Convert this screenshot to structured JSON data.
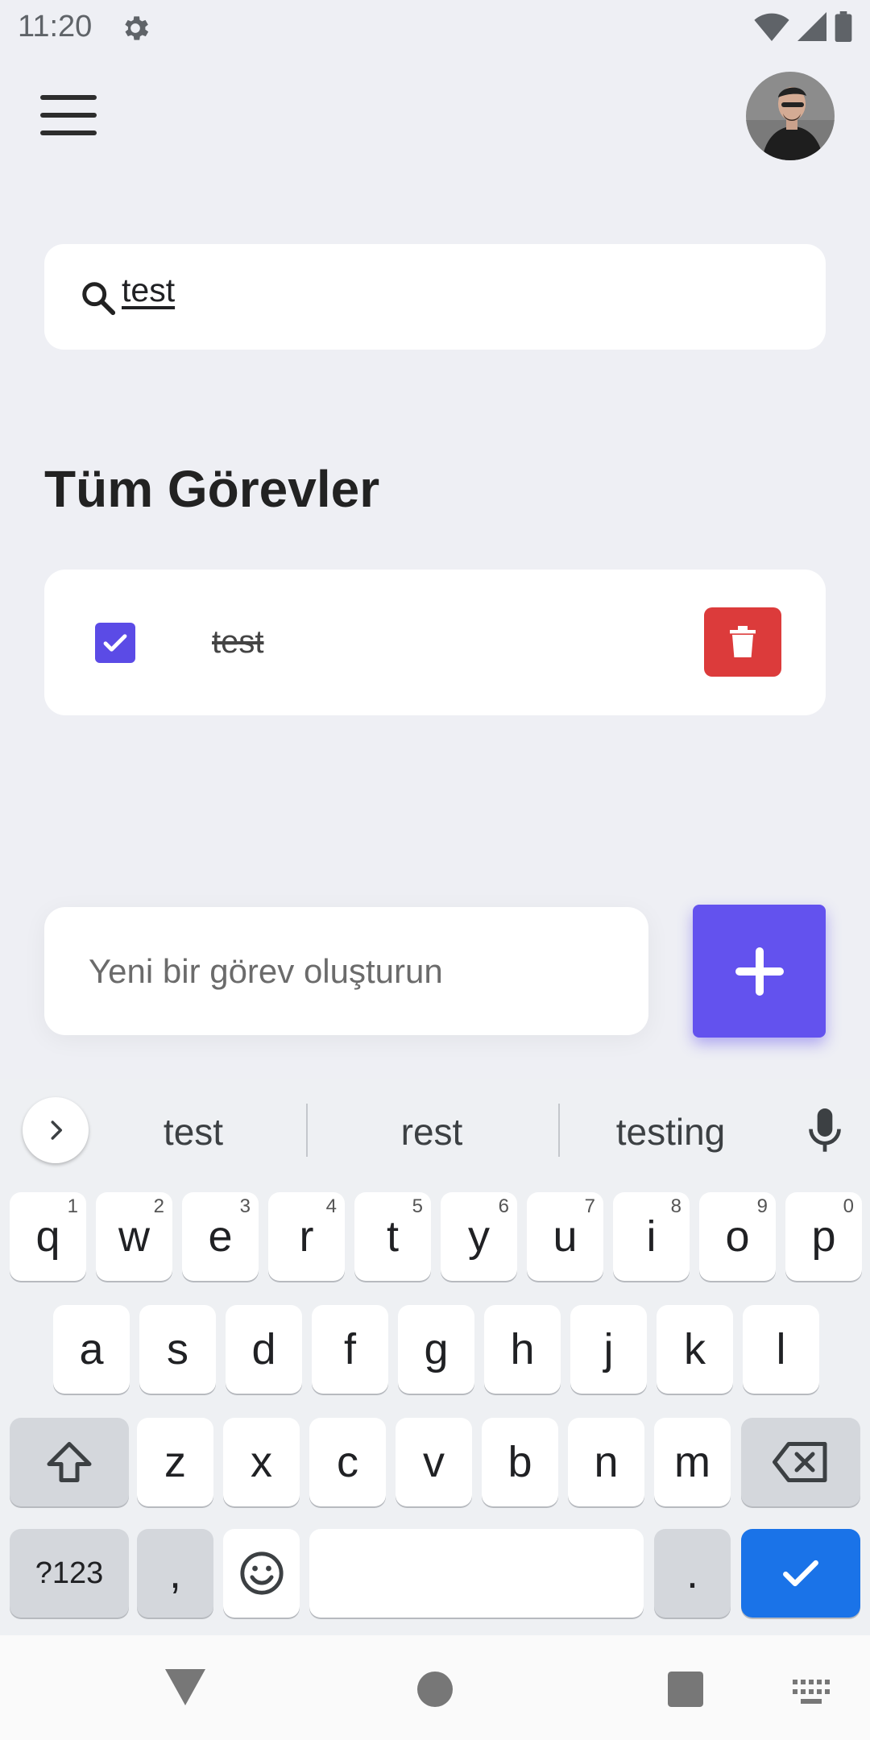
{
  "status_bar": {
    "time": "11:20"
  },
  "search": {
    "value": "test"
  },
  "section_title": "Tüm Görevler",
  "tasks": [
    {
      "title": "test",
      "done": true
    }
  ],
  "new_task": {
    "placeholder": "Yeni bir görev oluşturun"
  },
  "colors": {
    "accent": "#6352ee",
    "delete": "#dc3b3b",
    "background": "#eeeff4",
    "keyboard_action": "#1a73e8"
  },
  "keyboard": {
    "suggestions": [
      "test",
      "rest",
      "testing"
    ],
    "row1": [
      {
        "k": "q",
        "h": "1"
      },
      {
        "k": "w",
        "h": "2"
      },
      {
        "k": "e",
        "h": "3"
      },
      {
        "k": "r",
        "h": "4"
      },
      {
        "k": "t",
        "h": "5"
      },
      {
        "k": "y",
        "h": "6"
      },
      {
        "k": "u",
        "h": "7"
      },
      {
        "k": "i",
        "h": "8"
      },
      {
        "k": "o",
        "h": "9"
      },
      {
        "k": "p",
        "h": "0"
      }
    ],
    "row2": [
      "a",
      "s",
      "d",
      "f",
      "g",
      "h",
      "j",
      "k",
      "l"
    ],
    "row3": [
      "z",
      "x",
      "c",
      "v",
      "b",
      "n",
      "m"
    ],
    "symbols_label": "?123",
    "comma": ",",
    "period": "."
  }
}
